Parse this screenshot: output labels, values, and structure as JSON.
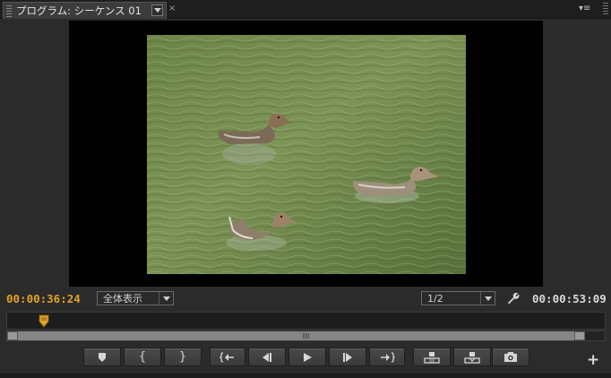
{
  "tab": {
    "title": "プログラム: シーケンス 01",
    "close_glyph": "×"
  },
  "panel": {
    "menu_glyph": "▾≡"
  },
  "monitor": {
    "current_timecode": "00:00:36:24",
    "zoom_level": "全体表示",
    "playback_resolution": "1/2",
    "duration_timecode": "00:00:53:09"
  },
  "ruler": {
    "zoom_grip": "III"
  },
  "transport": {
    "add_marker": "marker-icon",
    "mark_in": "{",
    "mark_out": "}",
    "go_to_in": "go-to-in-icon",
    "step_back": "step-back-icon",
    "play": "play-icon",
    "step_forward": "step-forward-icon",
    "go_to_out": "go-to-out-icon",
    "lift": "lift-icon",
    "extract": "extract-icon",
    "export_frame": "camera-icon"
  },
  "add_button": "+",
  "colors": {
    "current_timecode": "#e3a229",
    "background": "#2b2b2b",
    "video_water": "#6f8a4a"
  }
}
